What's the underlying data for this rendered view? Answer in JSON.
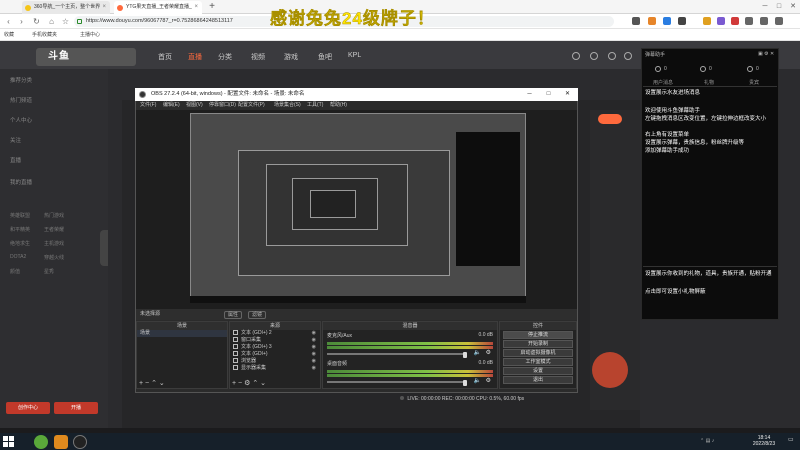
{
  "browser": {
    "tabs": [
      {
        "label": "360导航_一个主页，整个世界"
      },
      {
        "label": "YTG果天直播_王者荣耀直播_"
      }
    ],
    "url": "https://www.douyu.com/96067787_r=0.75286864248513117",
    "bookmarks": [
      {
        "label": "收藏"
      },
      {
        "label": "手机收藏夹"
      },
      {
        "label": "主播中心"
      }
    ]
  },
  "overlay_title": "感谢兔兔24级牌子！",
  "douyu": {
    "logo": "斗鱼",
    "nav": [
      "首页",
      "直播",
      "分类",
      "视频",
      "游戏",
      "鱼吧",
      "KPL"
    ],
    "nav_active": "直播",
    "sidebar_sections": [
      "推荐分类",
      "热门频道",
      "个人中心",
      "关注",
      "直播",
      "我的直播"
    ],
    "sidebar_sub": [
      "英雄联盟",
      "热门游戏",
      "和平精英",
      "王者荣耀",
      "绝地求生",
      "主机游戏",
      "DOTA2",
      "穿越火线",
      "颜值",
      "星秀"
    ],
    "sidebar_buttons": [
      "创作中心",
      "开播"
    ]
  },
  "chat": {
    "title": "弹幕助手",
    "counts": [
      "0",
      "0",
      "0"
    ],
    "tabs": [
      "用户消息",
      "礼物",
      "贵宾"
    ],
    "lines_top": [
      "设置展示水友进场消息",
      "",
      "欢迎使用斗鱼弹幕助手",
      "左键拖拽消息区改变位置，左键拉伸边框改变大小",
      "右上角有设置菜单",
      "设置展示弹幕，贵族信息，粉丝牌升级等",
      "添加弹幕助手成功"
    ],
    "lines_bottom": [
      "设置展示你收到的礼物，道具，贵族开通，贴粉开通",
      "点击即可设置小礼物屏蔽"
    ]
  },
  "obs": {
    "title": "OBS 27.2.4 (64-bit, windows) - 配置文件: 未命名 - 场景: 未命名",
    "menu": [
      "文件(F)",
      "编辑(E)",
      "视图(V)",
      "停靠窗口(D)",
      "配置文件(P)",
      "场景集合(S)",
      "工具(T)",
      "帮助(H)"
    ],
    "mode_label": "未选择源",
    "mode_buttons": [
      "属性",
      "滤镜"
    ],
    "docks": {
      "scenes": {
        "title": "场景",
        "items": [
          "场景"
        ]
      },
      "sources": {
        "title": "来源",
        "items": [
          "文本 (GDI+) 2",
          "窗口采集",
          "文本 (GDI+) 3",
          "文本 (GDI+)",
          "浏览器",
          "显示器采集"
        ]
      },
      "mixer": {
        "title": "混音器",
        "channels": [
          {
            "name": "麦克风/Aux",
            "db": "0.0 dB"
          },
          {
            "name": "桌面音频",
            "db": "0.0 dB"
          }
        ]
      },
      "controls": {
        "title": "控件",
        "buttons": [
          "停止推流",
          "开始录制",
          "启动虚拟摄像机",
          "工作室模式",
          "设置",
          "退出"
        ]
      }
    },
    "status": "LIVE: 00:00:00   REC: 00:00:00   CPU: 0.5%, 60.00 fps"
  },
  "taskbar": {
    "time": "18:14",
    "date": "2022/8/23"
  }
}
